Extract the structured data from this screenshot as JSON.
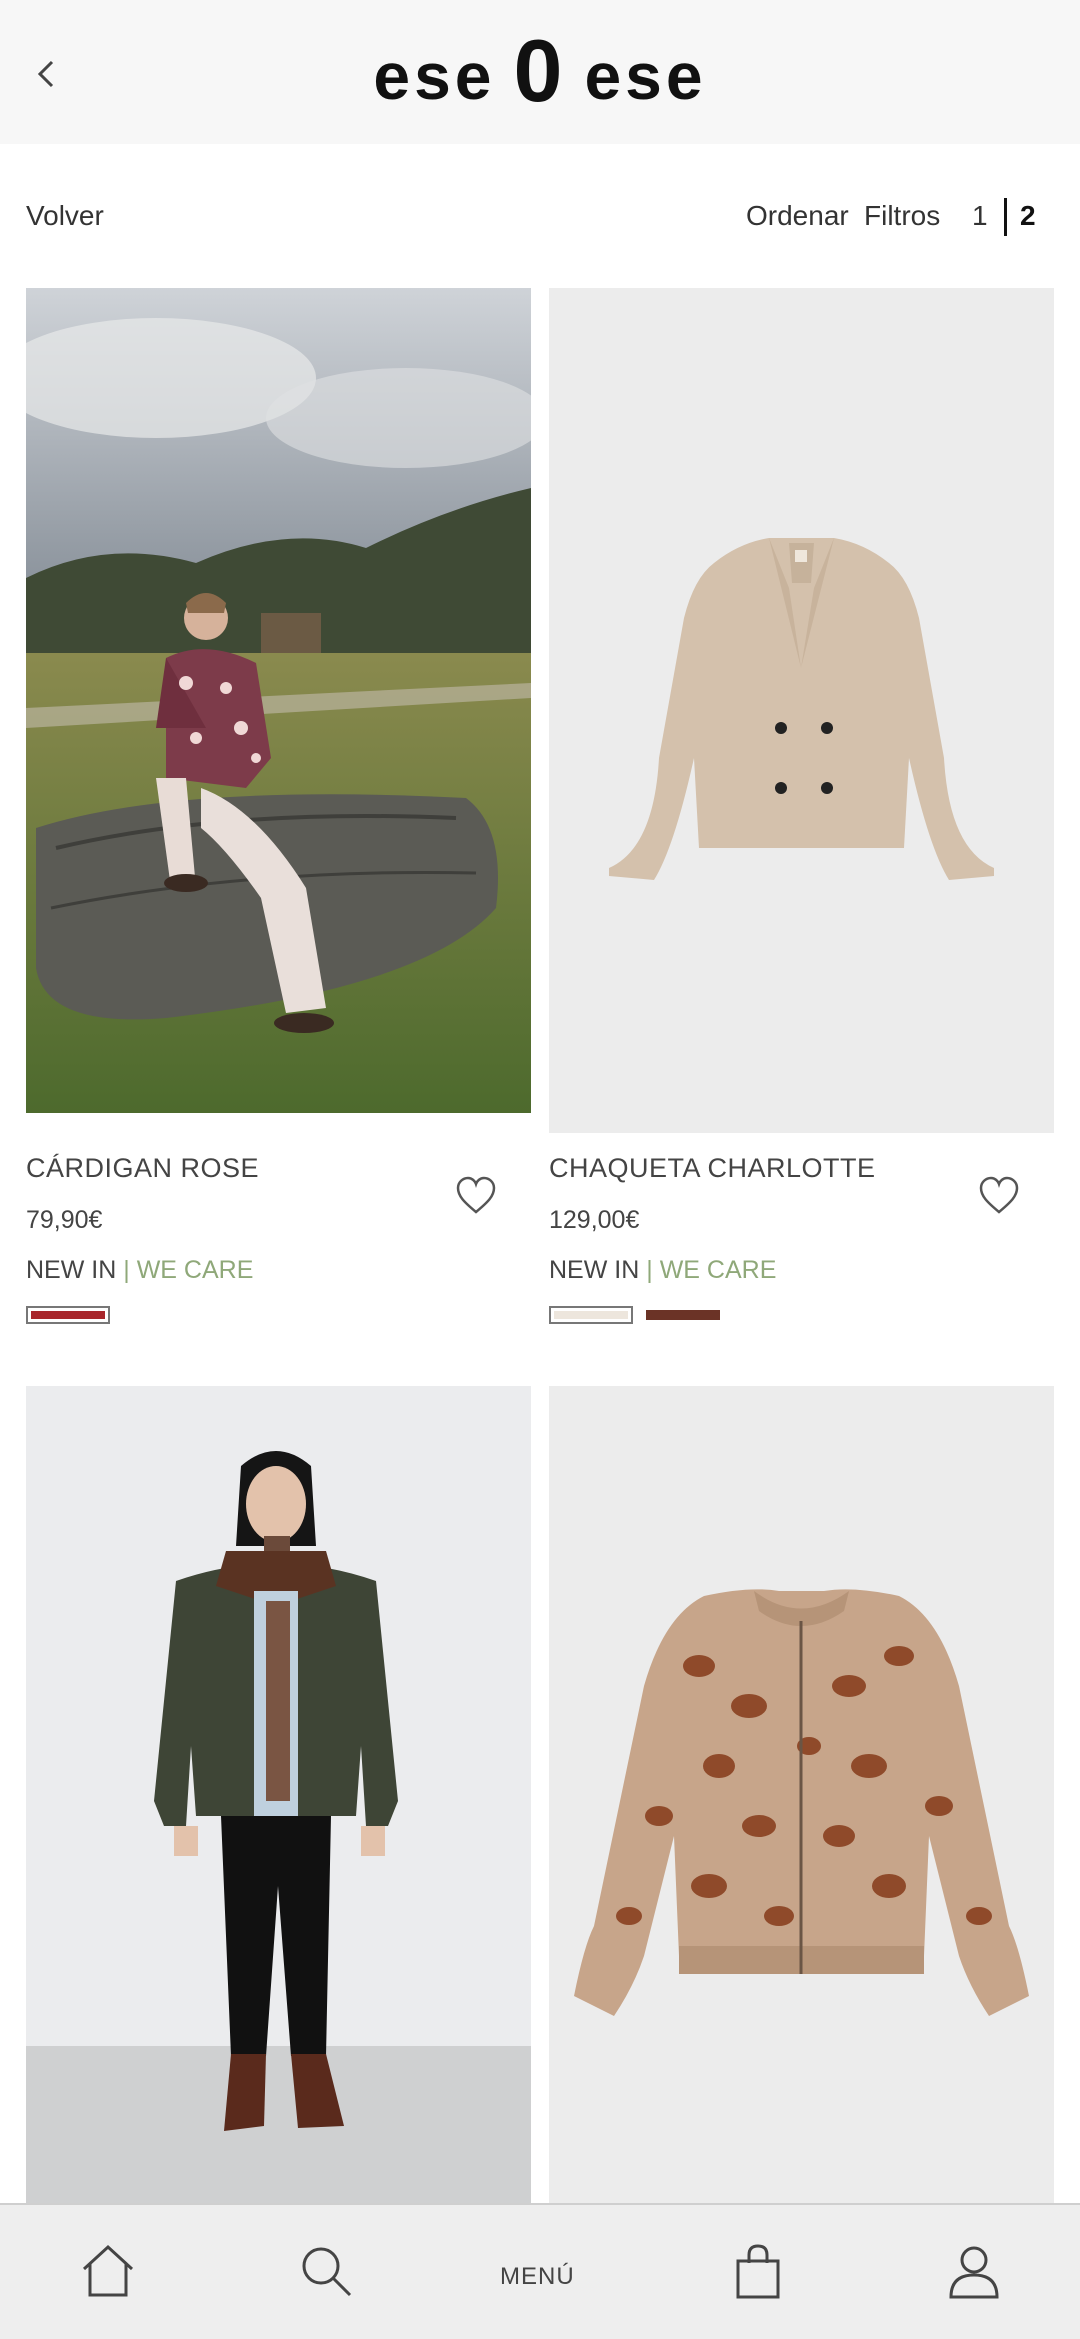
{
  "header": {
    "logo_left": "ese",
    "logo_mid": "0",
    "logo_right": "ese",
    "back_icon": "chevron-left-icon"
  },
  "toolbar": {
    "back_label": "Volver",
    "sort_label": "Ordenar",
    "filter_label": "Filtros",
    "pages": [
      "1",
      "2"
    ],
    "current_page": "2"
  },
  "products": [
    {
      "name": "CÁRDIGAN ROSE",
      "price": "79,90€",
      "tag_new": "NEW IN",
      "tag_sep": "|",
      "tag_care": "WE CARE",
      "swatches": [
        "#a8262b"
      ],
      "image": "model-leopard-cardigan-outdoor"
    },
    {
      "name": "CHAQUETA CHARLOTTE",
      "price": "129,00€",
      "tag_new": "NEW IN",
      "tag_sep": "|",
      "tag_care": "WE CARE",
      "swatches": [
        "#ede6dd",
        "#6b3326"
      ],
      "image": "beige-double-breasted-jacket"
    },
    {
      "image": "model-green-waxed-jacket"
    },
    {
      "image": "leopard-knit-bomber"
    }
  ],
  "bottom_nav": {
    "home_icon": "home-icon",
    "search_icon": "search-icon",
    "menu_label": "MENÚ",
    "bag_icon": "shopping-bag-icon",
    "account_icon": "user-icon"
  },
  "colors": {
    "header_bg": "#f7f7f7",
    "we_care_green": "#8fa879",
    "nav_bg": "#eeeeee"
  }
}
